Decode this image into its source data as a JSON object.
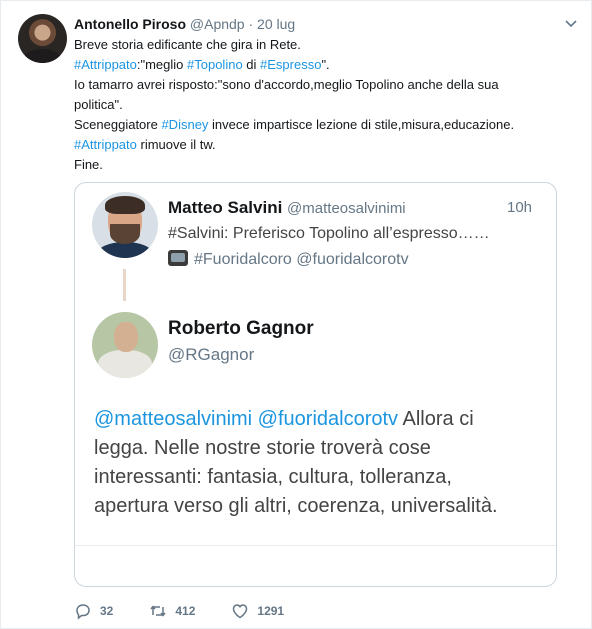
{
  "tweet": {
    "author_name": "Antonello Piroso",
    "handle": "@Apndp",
    "separator": "·",
    "date": "20 lug",
    "text_lines": [
      [
        {
          "t": "Breve storia edificante che gira in Rete."
        }
      ],
      [
        {
          "t": "#Attrippato",
          "h": true
        },
        {
          "t": ":\"meglio "
        },
        {
          "t": "#Topolino",
          "h": true
        },
        {
          "t": " di "
        },
        {
          "t": "#Espresso",
          "h": true
        },
        {
          "t": "\"."
        }
      ],
      [
        {
          "t": "Io tamarro avrei risposto:\"sono d'accordo,meglio Topolino anche della sua"
        }
      ],
      [
        {
          "t": "politica\"."
        }
      ],
      [
        {
          "t": "Sceneggiatore "
        },
        {
          "t": "#Disney",
          "h": true
        },
        {
          "t": " invece impartisce lezione di stile,misura,educazione."
        }
      ],
      [
        {
          "t": "#Attrippato",
          "h": true
        },
        {
          "t": " rimuove il tw."
        }
      ],
      [
        {
          "t": "Fine."
        }
      ]
    ],
    "counts": {
      "replies": "32",
      "retweets": "412",
      "likes": "1291"
    },
    "colors": {
      "link": "#1b95e0",
      "muted": "#657786",
      "text": "#14171a"
    }
  },
  "screenshot": {
    "first": {
      "name": "Matteo Salvini",
      "handle": "@matteosalvinimi",
      "time": "10h",
      "line1": "#Salvini: Preferisco Topolino all’espresso……",
      "line2": "#Fuoridalcoro @fuoridalcorotv"
    },
    "second": {
      "name": "Roberto Gagnor",
      "handle": "@RGagnor",
      "reply_lines": [
        [
          {
            "t": "@matteosalvinimi @fuoridalcorotv",
            "h": true
          },
          {
            "t": " Allora ci"
          }
        ],
        [
          {
            "t": "legga. Nelle nostre storie troverà cose"
          }
        ],
        [
          {
            "t": "interessanti: fantasia, cultura, tolleranza,"
          }
        ],
        [
          {
            "t": "apertura verso gli altri, coerenza, universalità."
          }
        ]
      ]
    }
  },
  "icons": [
    "caret-down-icon",
    "reply-icon",
    "retweet-icon",
    "like-icon",
    "tv-icon"
  ]
}
